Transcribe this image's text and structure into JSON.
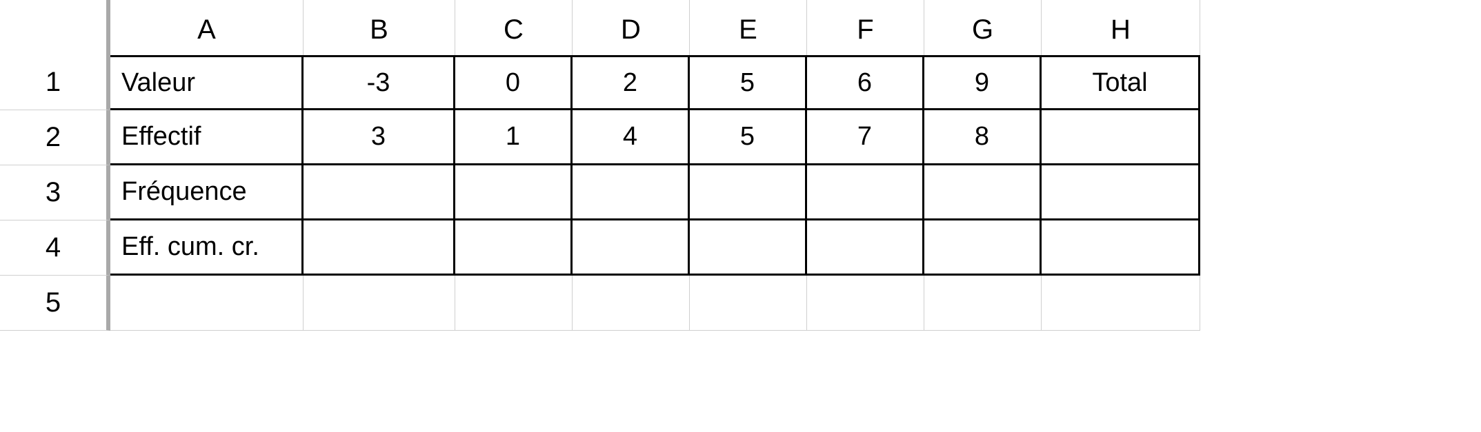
{
  "columns": [
    "A",
    "B",
    "C",
    "D",
    "E",
    "F",
    "G",
    "H"
  ],
  "rows": [
    "1",
    "2",
    "3",
    "4",
    "5"
  ],
  "table": {
    "r1": {
      "A": "Valeur",
      "B": "-3",
      "C": "0",
      "D": "2",
      "E": "5",
      "F": "6",
      "G": "9",
      "H": "Total"
    },
    "r2": {
      "A": "Effectif",
      "B": "3",
      "C": "1",
      "D": "4",
      "E": "5",
      "F": "7",
      "G": "8",
      "H": ""
    },
    "r3": {
      "A": "Fréquence",
      "B": "",
      "C": "",
      "D": "",
      "E": "",
      "F": "",
      "G": "",
      "H": ""
    },
    "r4": {
      "A": "Eff. cum. cr.",
      "B": "",
      "C": "",
      "D": "",
      "E": "",
      "F": "",
      "G": "",
      "H": ""
    },
    "r5": {
      "A": "",
      "B": "",
      "C": "",
      "D": "",
      "E": "",
      "F": "",
      "G": "",
      "H": ""
    }
  },
  "chart_data": {
    "type": "table",
    "headers_row": [
      "Valeur",
      "-3",
      "0",
      "2",
      "5",
      "6",
      "9",
      "Total"
    ],
    "rows": [
      [
        "Effectif",
        "3",
        "1",
        "4",
        "5",
        "7",
        "8",
        ""
      ],
      [
        "Fréquence",
        "",
        "",
        "",
        "",
        "",
        "",
        ""
      ],
      [
        "Eff. cum. cr.",
        "",
        "",
        "",
        "",
        "",
        "",
        ""
      ]
    ]
  }
}
